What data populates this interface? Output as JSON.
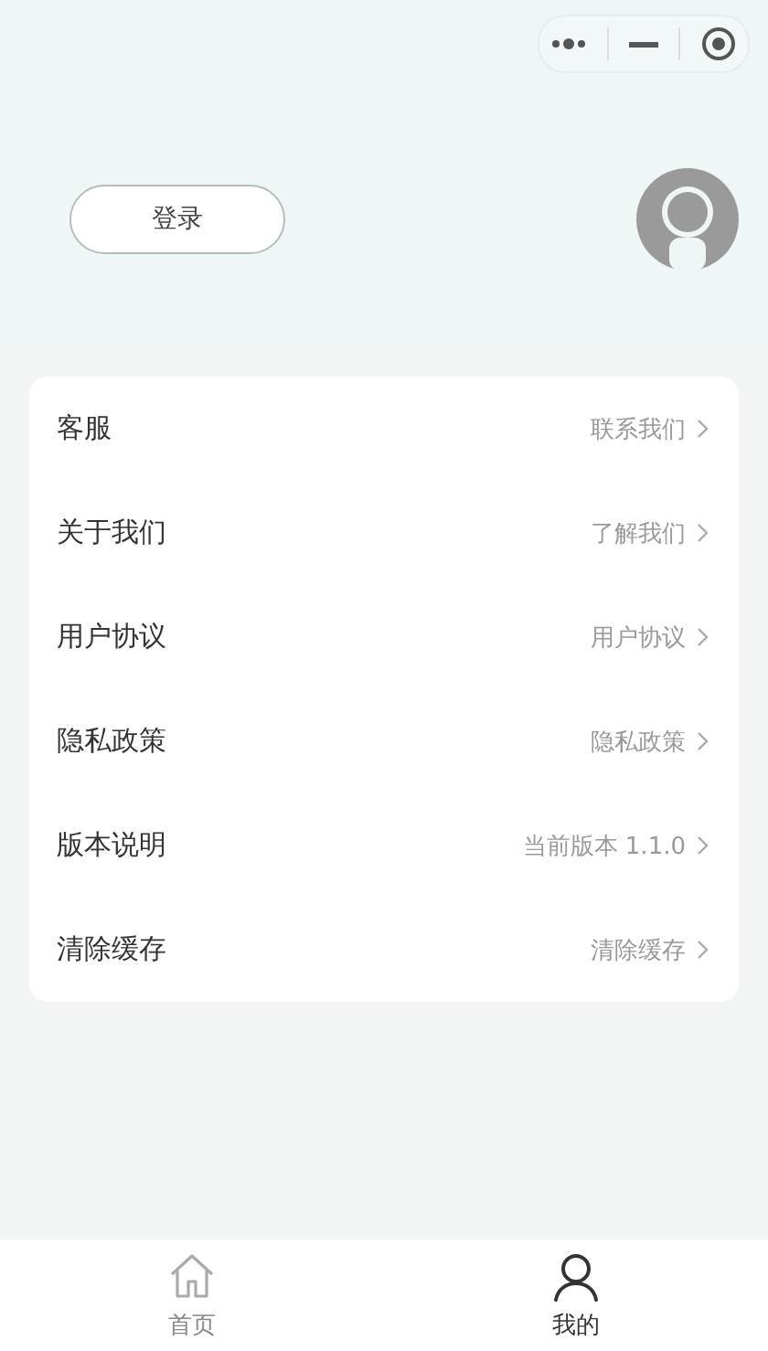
{
  "header": {
    "login_button": "登录"
  },
  "menu": [
    {
      "label": "客服",
      "value": "联系我们"
    },
    {
      "label": "关于我们",
      "value": "了解我们"
    },
    {
      "label": "用户协议",
      "value": "用户协议"
    },
    {
      "label": "隐私政策",
      "value": "隐私政策"
    },
    {
      "label": "版本说明",
      "value": "当前版本 1.1.0"
    },
    {
      "label": "清除缓存",
      "value": "清除缓存"
    }
  ],
  "tab_bar": [
    {
      "kind": "home",
      "label": "首页",
      "selected": false
    },
    {
      "kind": "user",
      "label": "我的",
      "selected": true
    }
  ]
}
